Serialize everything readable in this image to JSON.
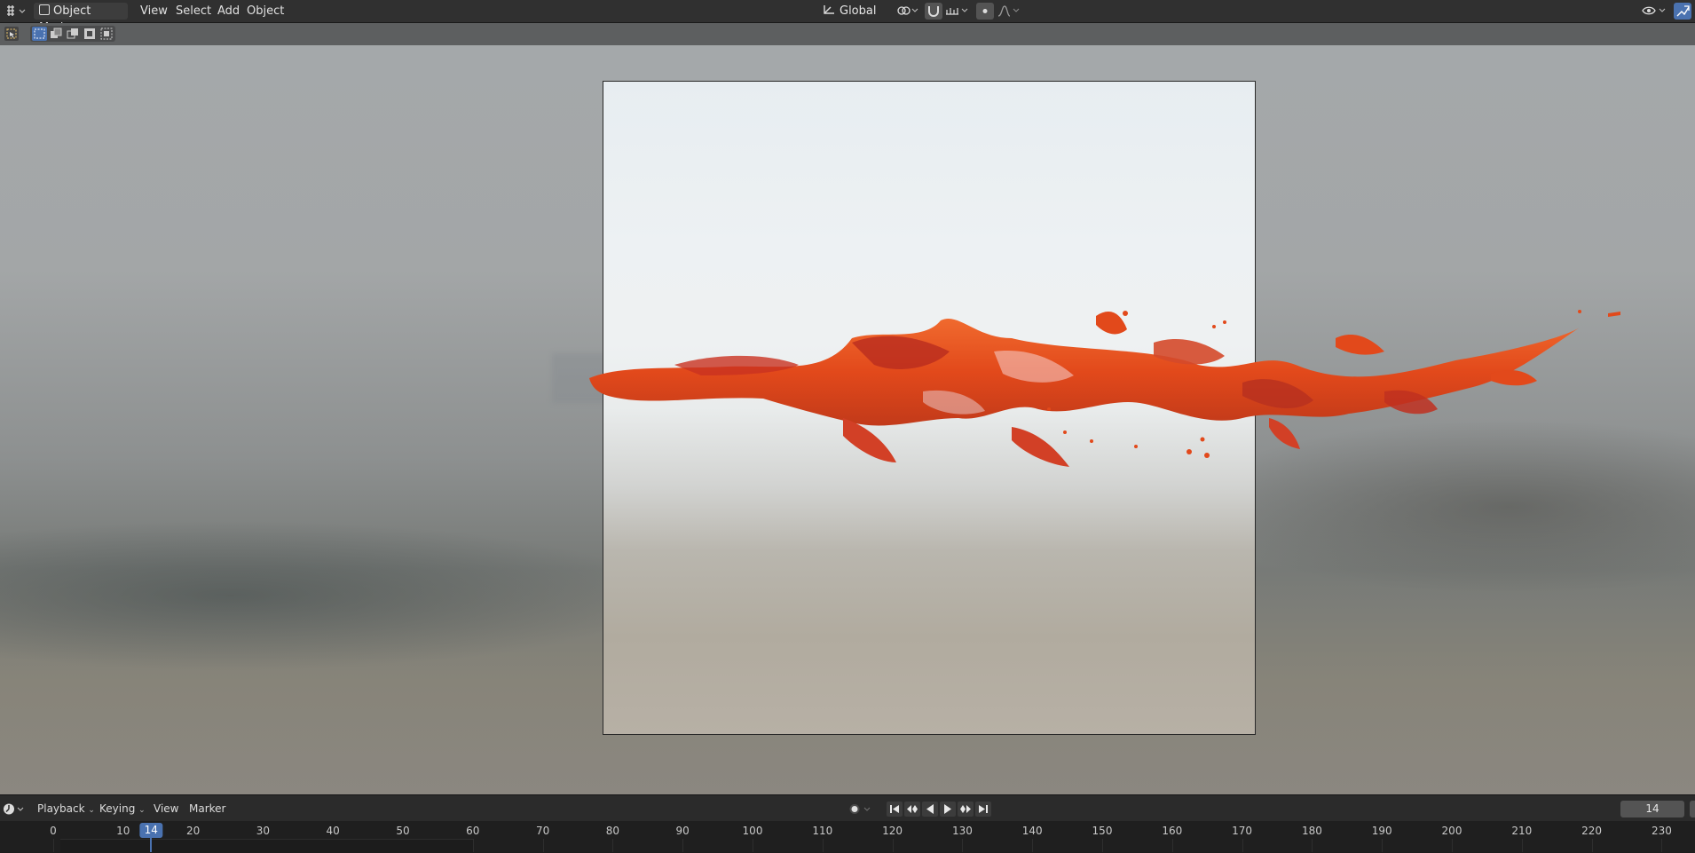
{
  "header": {
    "mode_dropdown": "Object Mode",
    "menus": [
      "View",
      "Select",
      "Add",
      "Object"
    ],
    "orientation": "Global"
  },
  "viewport": {
    "splash_color": "#e2491b"
  },
  "timeline_header": {
    "playback": "Playback",
    "keying": "Keying",
    "view": "View",
    "marker": "Marker",
    "current_frame": "14"
  },
  "timeline": {
    "ticks": [
      "0",
      "10",
      "20",
      "30",
      "40",
      "50",
      "60",
      "70",
      "80",
      "90",
      "100",
      "110",
      "120",
      "130",
      "140",
      "150",
      "160",
      "170",
      "180",
      "190",
      "200",
      "210",
      "220",
      "230"
    ],
    "current": "14"
  }
}
